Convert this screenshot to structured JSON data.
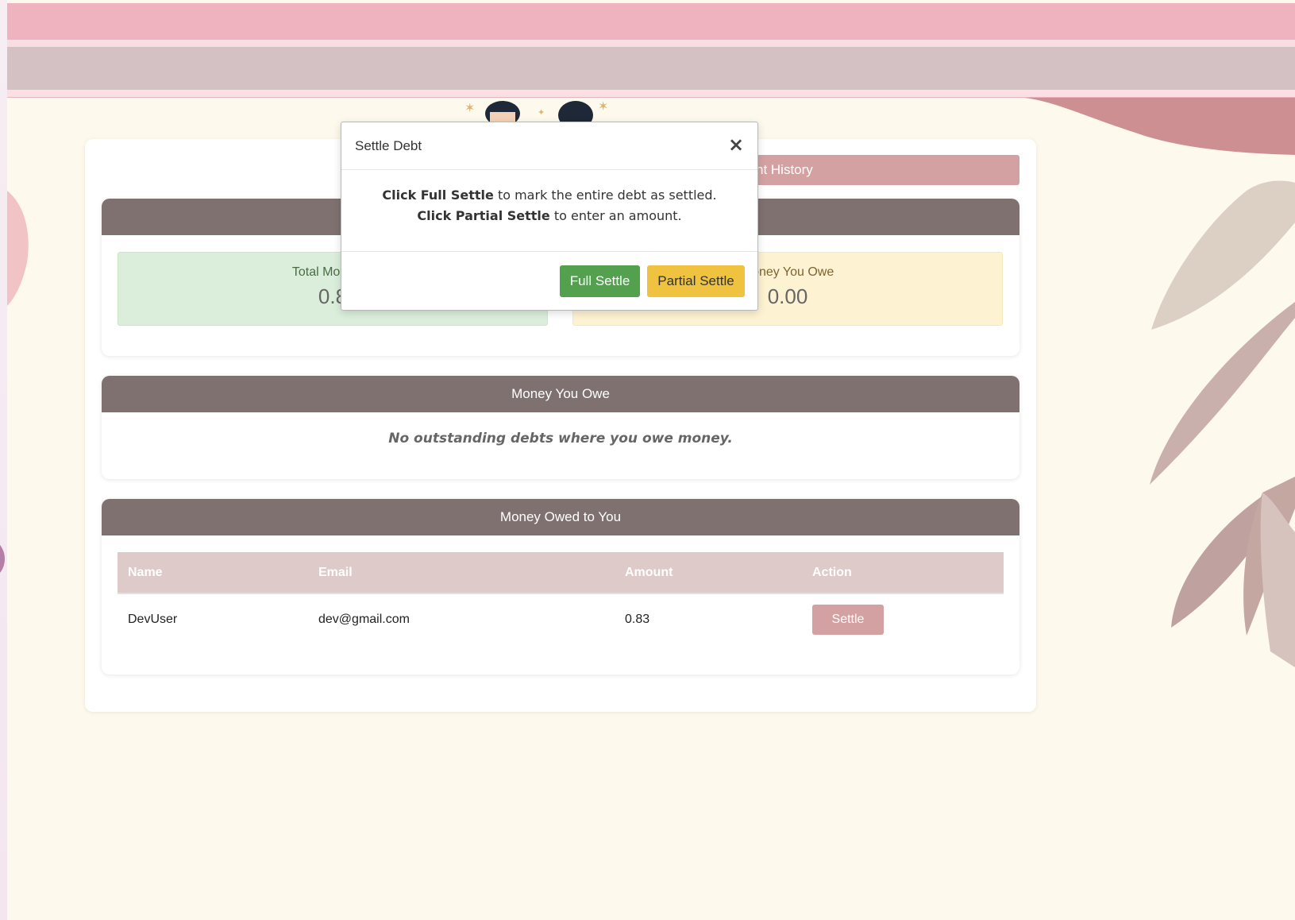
{
  "page": {
    "history_button_label": "nt History"
  },
  "summary": {
    "owed_to_you_label": "Total Money C",
    "owed_to_you_value": "0.8",
    "you_owe_label": "Money You Owe",
    "you_owe_value": "0.00"
  },
  "money_you_owe": {
    "title": "Money You Owe",
    "empty_message": "No outstanding debts where you owe money."
  },
  "money_owed_to_you": {
    "title": "Money Owed to You",
    "columns": [
      "Name",
      "Email",
      "Amount",
      "Action"
    ],
    "rows": [
      {
        "name": "DevUser",
        "email": "dev@gmail.com",
        "amount": "0.83",
        "action_label": "Settle"
      }
    ]
  },
  "modal": {
    "title": "Settle Debt",
    "close_symbol": "×",
    "line1_bold": "Click Full Settle",
    "line1_rest": " to mark the entire debt as settled.",
    "line2_bold": "Click Partial Settle",
    "line2_rest": " to enter an amount.",
    "full_settle_label": "Full Settle",
    "partial_settle_label": "Partial Settle"
  },
  "colors": {
    "background": "#fdf9ec",
    "topbar": "#efb3bf",
    "panel_header": "#7e716f",
    "accent_button": "#d4a1a2",
    "full_settle": "#53a04f",
    "partial_settle": "#efc23f"
  }
}
